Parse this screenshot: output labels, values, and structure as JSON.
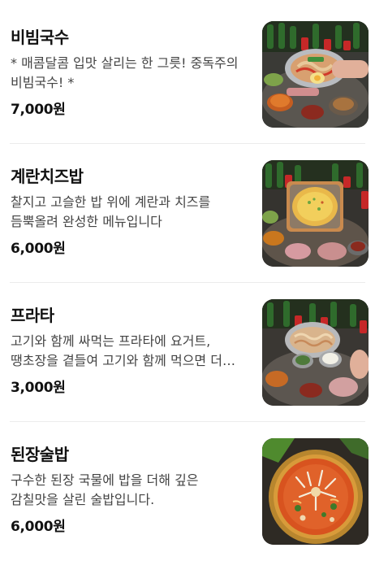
{
  "menu": {
    "items": [
      {
        "name": "비빔국수",
        "description": "* 매콤달콤 입맛 살리는 한 그릇! 중독주의 비빔국수! *",
        "price": "7,000원",
        "photo_icon": "bibim-noodle-photo"
      },
      {
        "name": "계란치즈밥",
        "description": "찰지고 고슬한 밥 위에 계란과 치즈를 듬뿍올려 완성한 메뉴입니다",
        "price": "6,000원",
        "photo_icon": "egg-cheese-rice-photo"
      },
      {
        "name": "프라타",
        "description": "고기와 함께 싸먹는 프라타에 요거트, 땡초장을 곁들여 고기와 함께 먹으면 더 맛있어요",
        "price": "3,000원",
        "photo_icon": "prata-photo"
      },
      {
        "name": "된장술밥",
        "description": "구수한 된장 국물에 밥을 더해 깊은 감칠맛을 살린 술밥입니다.",
        "price": "6,000원",
        "photo_icon": "doenjang-rice-photo"
      }
    ]
  }
}
